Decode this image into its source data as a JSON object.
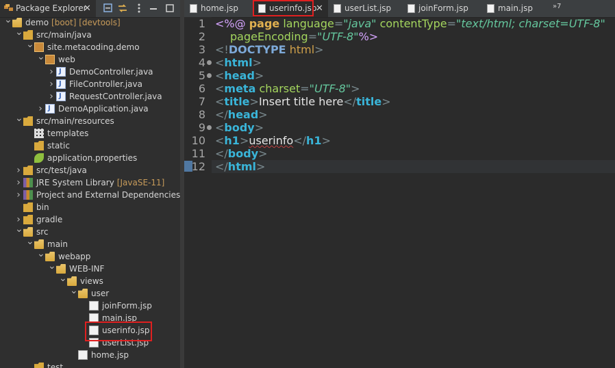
{
  "explorer": {
    "tab_label": "Package Explorer",
    "tree": [
      {
        "label": "demo",
        "decor": "[boot] [devtools]",
        "icon": "project-icon",
        "arrow": "down",
        "depth": 0
      },
      {
        "label": "src/main/java",
        "icon": "source-folder-icon",
        "arrow": "down",
        "depth": 1
      },
      {
        "label": "site.metacoding.demo",
        "icon": "package-icon",
        "arrow": "down",
        "depth": 2
      },
      {
        "label": "web",
        "icon": "package-icon",
        "arrow": "down",
        "depth": 3
      },
      {
        "label": "DemoController.java",
        "icon": "java-file-icon",
        "arrow": "right",
        "depth": 4
      },
      {
        "label": "FileController.java",
        "icon": "java-file-icon",
        "arrow": "right",
        "depth": 4
      },
      {
        "label": "RequestController.java",
        "icon": "java-file-icon",
        "arrow": "right",
        "depth": 4
      },
      {
        "label": "DemoApplication.java",
        "icon": "java-file-icon",
        "arrow": "right",
        "depth": 3
      },
      {
        "label": "src/main/resources",
        "icon": "source-folder-icon",
        "arrow": "down",
        "depth": 1
      },
      {
        "label": "templates",
        "icon": "folder-grid-icon",
        "arrow": "",
        "depth": 2
      },
      {
        "label": "static",
        "icon": "folder-icon",
        "arrow": "",
        "depth": 2
      },
      {
        "label": "application.properties",
        "icon": "spring-leaf-icon",
        "arrow": "",
        "depth": 2
      },
      {
        "label": "src/test/java",
        "icon": "source-folder-icon",
        "arrow": "right",
        "depth": 1
      },
      {
        "label": "JRE System Library",
        "decor": "[JavaSE-11]",
        "icon": "library-icon",
        "arrow": "right",
        "depth": 1
      },
      {
        "label": "Project and External Dependencies",
        "icon": "library-icon",
        "arrow": "right",
        "depth": 1
      },
      {
        "label": "bin",
        "icon": "folder-icon",
        "arrow": "",
        "depth": 1
      },
      {
        "label": "gradle",
        "icon": "folder-icon",
        "arrow": "right",
        "depth": 1
      },
      {
        "label": "src",
        "icon": "folder-open-icon",
        "arrow": "down",
        "depth": 1
      },
      {
        "label": "main",
        "icon": "folder-open-icon",
        "arrow": "down",
        "depth": 2
      },
      {
        "label": "webapp",
        "icon": "folder-open-icon",
        "arrow": "down",
        "depth": 3
      },
      {
        "label": "WEB-INF",
        "icon": "folder-open-icon",
        "arrow": "down",
        "depth": 4
      },
      {
        "label": "views",
        "icon": "folder-open-icon",
        "arrow": "down",
        "depth": 5
      },
      {
        "label": "user",
        "icon": "folder-open-icon",
        "arrow": "down",
        "depth": 6
      },
      {
        "label": "joinForm.jsp",
        "icon": "jsp-file-icon",
        "arrow": "",
        "depth": 7
      },
      {
        "label": "main.jsp",
        "icon": "jsp-file-icon",
        "arrow": "",
        "depth": 7
      },
      {
        "label": "userinfo.jsp",
        "icon": "jsp-file-icon",
        "arrow": "",
        "depth": 7
      },
      {
        "label": "userList.jsp",
        "icon": "jsp-file-icon",
        "arrow": "",
        "depth": 7
      },
      {
        "label": "home.jsp",
        "icon": "jsp-file-icon",
        "arrow": "",
        "depth": 6
      },
      {
        "label": "test",
        "icon": "folder-icon",
        "arrow": "",
        "depth": 2
      }
    ]
  },
  "editor": {
    "tabs": [
      {
        "label": "home.jsp",
        "active": false
      },
      {
        "label": "userinfo.jsp",
        "active": true
      },
      {
        "label": "userList.jsp",
        "active": false
      },
      {
        "label": "joinForm.jsp",
        "active": false
      },
      {
        "label": "main.jsp",
        "active": false
      }
    ],
    "overflow_label": "»7",
    "line_numbers": [
      "1",
      "2",
      "3",
      "4",
      "5",
      "6",
      "7",
      "8",
      "9",
      "10",
      "11",
      "12"
    ],
    "code": {
      "l1": {
        "open": "<%@ ",
        "kw": "page",
        "a1": " language",
        "eq1": "=",
        "s1": "\"java\"",
        "a2": " contentType",
        "eq2": "=",
        "s2": "\"text/html; charset=UTF-8\""
      },
      "l2": {
        "a": "pageEncoding",
        "eq": "=",
        "s": "\"UTF-8\"",
        "close": "%>"
      },
      "l3": {
        "open": "<!",
        "kw": "DOCTYPE",
        "rest": " html",
        "close": ">"
      },
      "l4": {
        "open": "<",
        "tag": "html",
        "close": ">"
      },
      "l5": {
        "open": "<",
        "tag": "head",
        "close": ">"
      },
      "l6": {
        "open": "<",
        "tag": "meta",
        "a": " charset",
        "eq": "=",
        "s": "\"UTF-8\"",
        "close": ">"
      },
      "l7": {
        "open": "<",
        "tag": "title",
        "close": ">",
        "text": "Insert title here",
        "open2": "</",
        "tag2": "title",
        "close2": ">"
      },
      "l8": {
        "open": "</",
        "tag": "head",
        "close": ">"
      },
      "l9": {
        "open": "<",
        "tag": "body",
        "close": ">"
      },
      "l10": {
        "open": "<",
        "tag": "h1",
        "close": ">",
        "text": "userinfo",
        "open2": "</",
        "tag2": "h1",
        "close2": ">"
      },
      "l11": {
        "open": "</",
        "tag": "body",
        "close": ">"
      },
      "l12": {
        "open": "</",
        "tag": "html",
        "close": ">"
      }
    }
  }
}
